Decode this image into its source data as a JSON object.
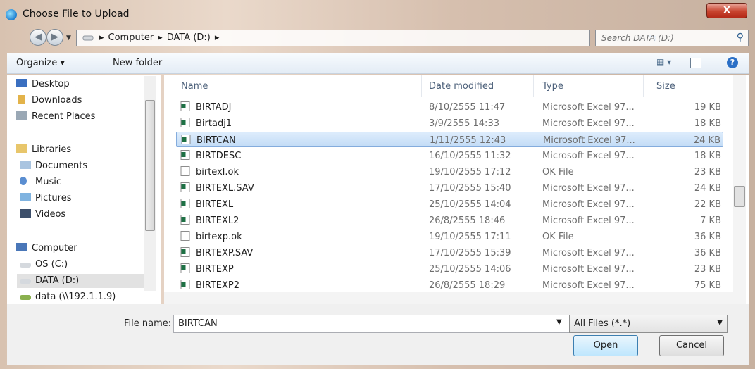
{
  "window": {
    "title": "Choose File to Upload",
    "close_label": "X"
  },
  "nav": {
    "back_icon": "back-arrow-icon",
    "forward_icon": "forward-arrow-icon",
    "breadcrumbs": [
      "Computer",
      "DATA (D:)"
    ],
    "search_placeholder": "Search DATA (D:)"
  },
  "toolbar": {
    "organize_label": "Organize ▾",
    "new_folder_label": "New folder"
  },
  "sidebar": {
    "items": [
      {
        "label": "Desktop"
      },
      {
        "label": "Downloads"
      },
      {
        "label": "Recent Places"
      },
      {
        "label": "Libraries"
      },
      {
        "label": "Documents"
      },
      {
        "label": "Music"
      },
      {
        "label": "Pictures"
      },
      {
        "label": "Videos"
      },
      {
        "label": "Computer"
      },
      {
        "label": "OS (C:)"
      },
      {
        "label": "DATA (D:)"
      },
      {
        "label": "data (\\\\192.1.1.9)"
      }
    ]
  },
  "columns": {
    "name": "Name",
    "date": "Date modified",
    "type": "Type",
    "size": "Size"
  },
  "files": [
    {
      "name": "BIRTADJ",
      "date": "8/10/2555 11:47",
      "type": "Microsoft Excel 97...",
      "size": "19 KB",
      "kind": "excel"
    },
    {
      "name": "Birtadj1",
      "date": "3/9/2555 14:33",
      "type": "Microsoft Excel 97...",
      "size": "18 KB",
      "kind": "excel"
    },
    {
      "name": "BIRTCAN",
      "date": "1/11/2555 12:43",
      "type": "Microsoft Excel 97...",
      "size": "24 KB",
      "kind": "excel",
      "selected": true
    },
    {
      "name": "BIRTDESC",
      "date": "16/10/2555 11:32",
      "type": "Microsoft Excel 97...",
      "size": "18 KB",
      "kind": "excel"
    },
    {
      "name": "birtexl.ok",
      "date": "19/10/2555 17:12",
      "type": "OK File",
      "size": "23 KB",
      "kind": "file"
    },
    {
      "name": "BIRTEXL.SAV",
      "date": "17/10/2555 15:40",
      "type": "Microsoft Excel 97...",
      "size": "24 KB",
      "kind": "excel"
    },
    {
      "name": "BIRTEXL",
      "date": "25/10/2555 14:04",
      "type": "Microsoft Excel 97...",
      "size": "22 KB",
      "kind": "excel"
    },
    {
      "name": "BIRTEXL2",
      "date": "26/8/2555 18:46",
      "type": "Microsoft Excel 97...",
      "size": "7 KB",
      "kind": "excel"
    },
    {
      "name": "birtexp.ok",
      "date": "19/10/2555 17:11",
      "type": "OK File",
      "size": "36 KB",
      "kind": "file"
    },
    {
      "name": "BIRTEXP.SAV",
      "date": "17/10/2555 15:39",
      "type": "Microsoft Excel 97...",
      "size": "36 KB",
      "kind": "excel"
    },
    {
      "name": "BIRTEXP",
      "date": "25/10/2555 14:06",
      "type": "Microsoft Excel 97...",
      "size": "23 KB",
      "kind": "excel"
    },
    {
      "name": "BIRTEXP2",
      "date": "26/8/2555 18:29",
      "type": "Microsoft Excel 97...",
      "size": "75 KB",
      "kind": "excel"
    }
  ],
  "footer": {
    "filename_label": "File name:",
    "filename_value": "BIRTCAN",
    "filter_value": "All Files (*.*)",
    "open_label": "Open",
    "cancel_label": "Cancel"
  },
  "colors": {
    "selection": "#cce4f7",
    "selection_border": "#84acdd",
    "excel_green": "#1e7145"
  }
}
